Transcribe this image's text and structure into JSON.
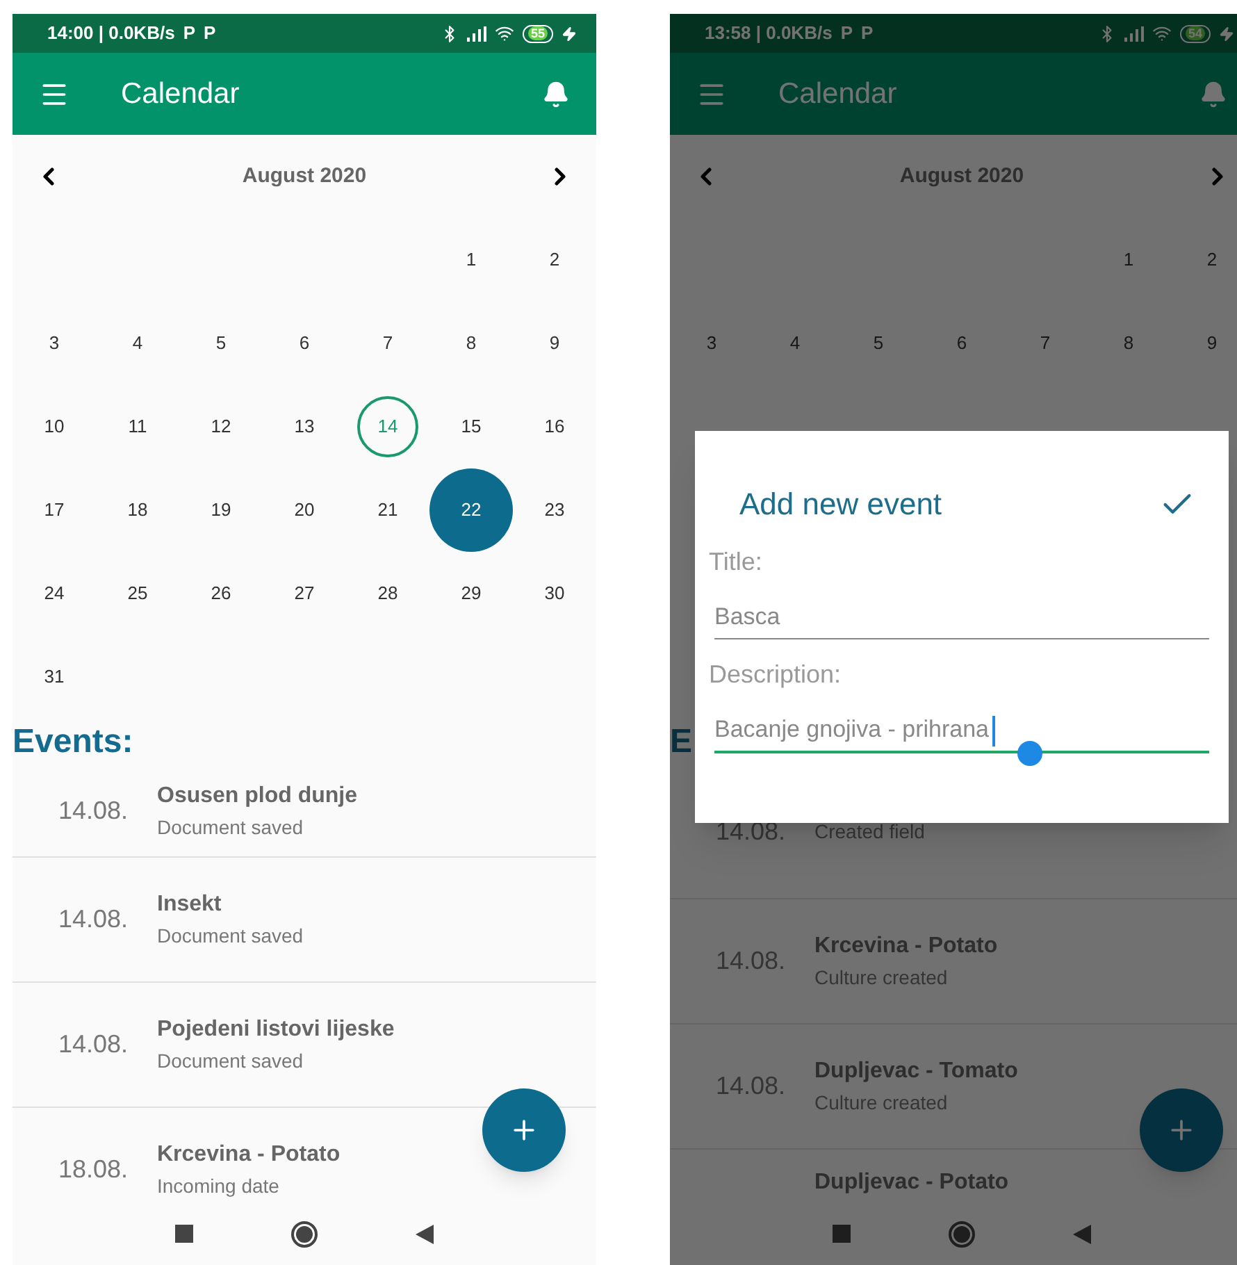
{
  "screens": [
    {
      "dimmed": false,
      "status_bar": {
        "time": "14:00 | 0.0KB/s",
        "notifications": [
          "P",
          "P"
        ],
        "battery": "55"
      },
      "app_bar": {
        "title": "Calendar"
      },
      "calendar": {
        "month": "August 2020",
        "weeks": [
          [
            {
              "kind": "blank"
            },
            {
              "kind": "blank"
            },
            {
              "kind": "blank"
            },
            {
              "kind": "blank"
            },
            {
              "kind": "blank"
            },
            {
              "kind": "day",
              "label": "1",
              "today": false,
              "selected": false
            },
            {
              "kind": "day",
              "label": "2",
              "today": false,
              "selected": false
            }
          ],
          [
            {
              "kind": "day",
              "label": "3",
              "today": false,
              "selected": false
            },
            {
              "kind": "day",
              "label": "4",
              "today": false,
              "selected": false
            },
            {
              "kind": "day",
              "label": "5",
              "today": false,
              "selected": false
            },
            {
              "kind": "day",
              "label": "6",
              "today": false,
              "selected": false
            },
            {
              "kind": "day",
              "label": "7",
              "today": false,
              "selected": false
            },
            {
              "kind": "day",
              "label": "8",
              "today": false,
              "selected": false
            },
            {
              "kind": "day",
              "label": "9",
              "today": false,
              "selected": false
            }
          ],
          [
            {
              "kind": "day",
              "label": "10",
              "today": false,
              "selected": false
            },
            {
              "kind": "day",
              "label": "11",
              "today": false,
              "selected": false
            },
            {
              "kind": "day",
              "label": "12",
              "today": false,
              "selected": false
            },
            {
              "kind": "day",
              "label": "13",
              "today": false,
              "selected": false
            },
            {
              "kind": "day",
              "label": "14",
              "today": true,
              "selected": false
            },
            {
              "kind": "day",
              "label": "15",
              "today": false,
              "selected": false
            },
            {
              "kind": "day",
              "label": "16",
              "today": false,
              "selected": false
            }
          ],
          [
            {
              "kind": "day",
              "label": "17",
              "today": false,
              "selected": false
            },
            {
              "kind": "day",
              "label": "18",
              "today": false,
              "selected": false
            },
            {
              "kind": "day",
              "label": "19",
              "today": false,
              "selected": false
            },
            {
              "kind": "day",
              "label": "20",
              "today": false,
              "selected": false
            },
            {
              "kind": "day",
              "label": "21",
              "today": false,
              "selected": false
            },
            {
              "kind": "day",
              "label": "22",
              "today": false,
              "selected": true
            },
            {
              "kind": "day",
              "label": "23",
              "today": false,
              "selected": false
            }
          ],
          [
            {
              "kind": "day",
              "label": "24",
              "today": false,
              "selected": false
            },
            {
              "kind": "day",
              "label": "25",
              "today": false,
              "selected": false
            },
            {
              "kind": "day",
              "label": "26",
              "today": false,
              "selected": false
            },
            {
              "kind": "day",
              "label": "27",
              "today": false,
              "selected": false
            },
            {
              "kind": "day",
              "label": "28",
              "today": false,
              "selected": false
            },
            {
              "kind": "day",
              "label": "29",
              "today": false,
              "selected": false
            },
            {
              "kind": "day",
              "label": "30",
              "today": false,
              "selected": false
            }
          ],
          [
            {
              "kind": "day",
              "label": "31",
              "today": false,
              "selected": false
            }
          ]
        ]
      },
      "events_heading": "Events:",
      "events": [
        {
          "date": "14.08.",
          "title": "Osusen plod dunje",
          "subtitle": "Document saved"
        },
        {
          "date": "14.08.",
          "title": "Insekt",
          "subtitle": "Document saved"
        },
        {
          "date": "14.08.",
          "title": "Pojedeni listovi lijeske",
          "subtitle": "Document saved"
        },
        {
          "date": "18.08.",
          "title": "Krcevina - Potato",
          "subtitle": "Incoming date"
        }
      ]
    },
    {
      "dimmed": true,
      "status_bar": {
        "time": "13:58 | 0.0KB/s",
        "notifications": [
          "P",
          "P"
        ],
        "battery": "54"
      },
      "app_bar": {
        "title": "Calendar"
      },
      "calendar": {
        "month": "August 2020",
        "weeks": [
          [
            {
              "kind": "blank"
            },
            {
              "kind": "blank"
            },
            {
              "kind": "blank"
            },
            {
              "kind": "blank"
            },
            {
              "kind": "blank"
            },
            {
              "kind": "day",
              "label": "1",
              "today": false,
              "selected": false
            },
            {
              "kind": "day",
              "label": "2",
              "today": false,
              "selected": false
            }
          ],
          [
            {
              "kind": "day",
              "label": "3",
              "today": false,
              "selected": false
            },
            {
              "kind": "day",
              "label": "4",
              "today": false,
              "selected": false
            },
            {
              "kind": "day",
              "label": "5",
              "today": false,
              "selected": false
            },
            {
              "kind": "day",
              "label": "6",
              "today": false,
              "selected": false
            },
            {
              "kind": "day",
              "label": "7",
              "today": false,
              "selected": false
            },
            {
              "kind": "day",
              "label": "8",
              "today": false,
              "selected": false
            },
            {
              "kind": "day",
              "label": "9",
              "today": false,
              "selected": false
            }
          ]
        ]
      },
      "events_heading": "E",
      "events": [
        {
          "date": "14.08.",
          "subtitle": "Created field"
        },
        {
          "date": "14.08.",
          "title": "Krcevina - Potato",
          "subtitle": "Culture created"
        },
        {
          "date": "14.08.",
          "title": "Dupljevac - Tomato",
          "subtitle": "Culture created"
        },
        {
          "title": "Dupljevac - Potato"
        }
      ],
      "dialog": {
        "title": "Add new event",
        "fields": [
          {
            "label": "Title:",
            "value": "Basca",
            "focused": false
          },
          {
            "label": "Description:",
            "value": "Bacanje gnojiva - prihrana",
            "focused": true
          }
        ]
      }
    }
  ]
}
